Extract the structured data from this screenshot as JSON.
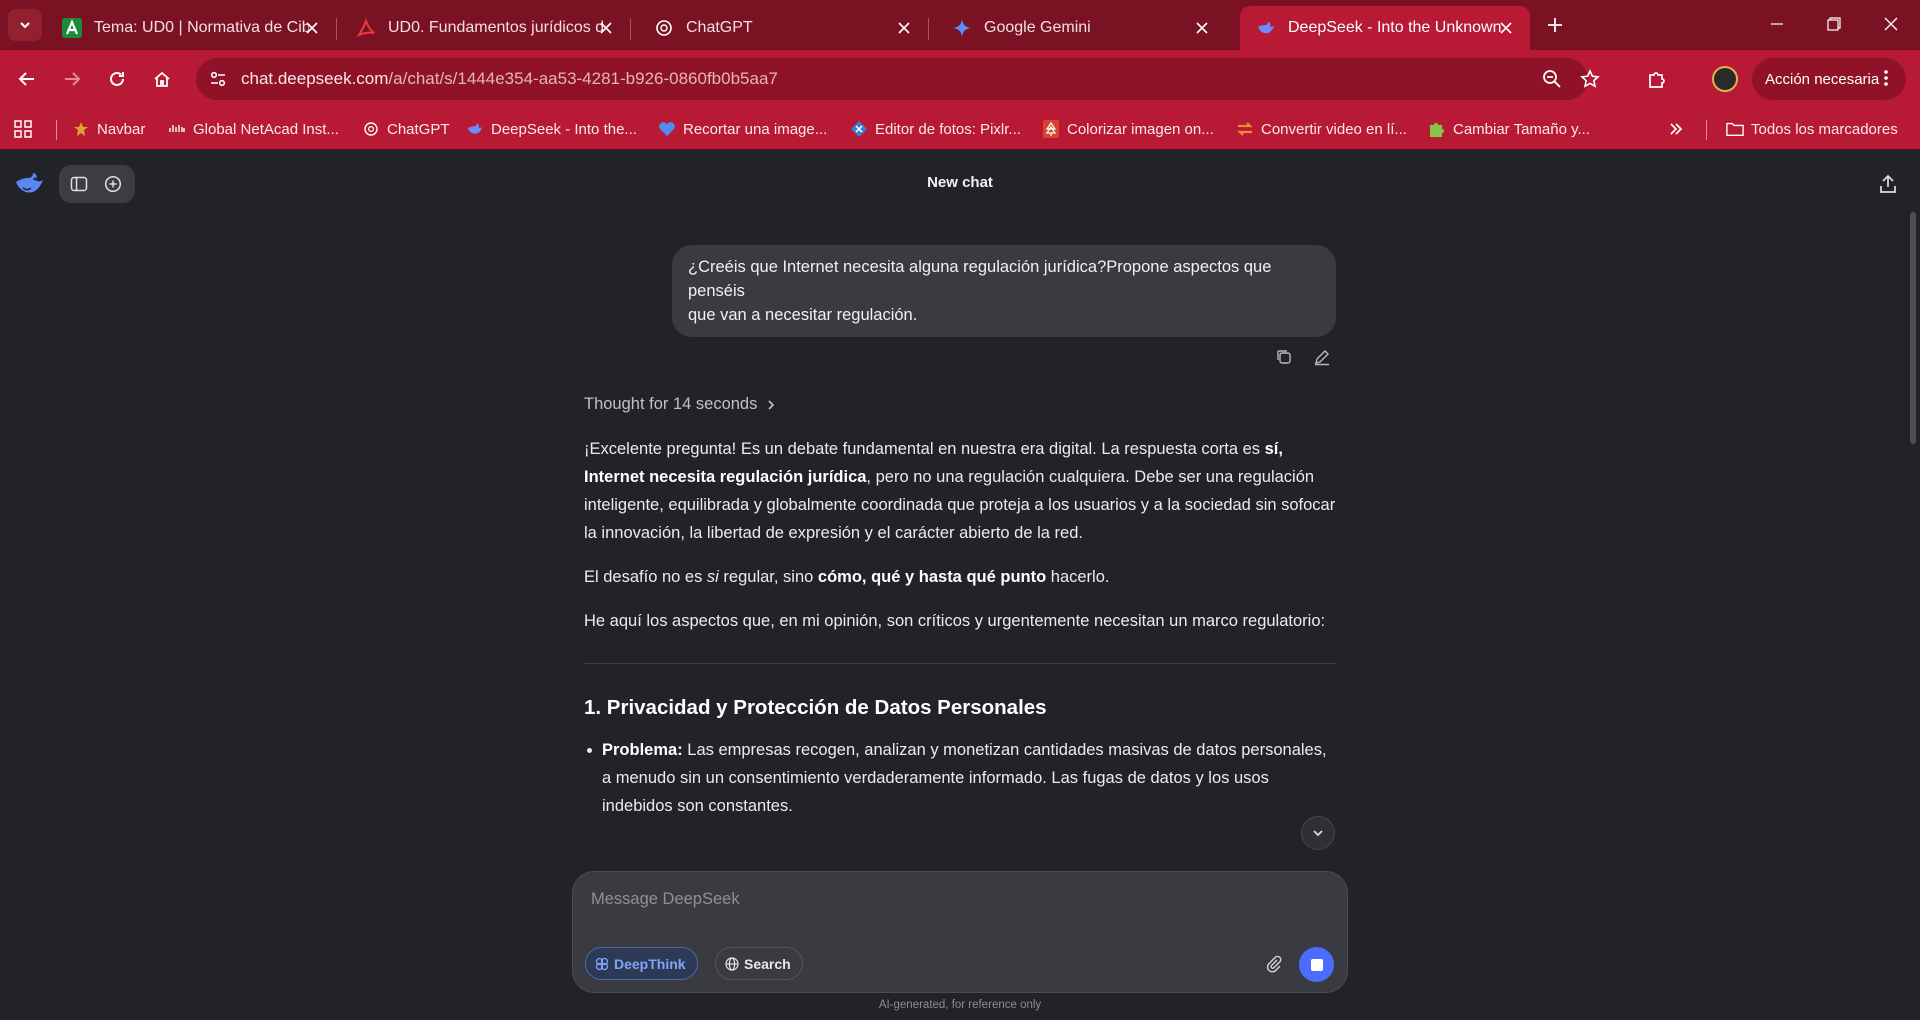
{
  "browser": {
    "tabs": [
      {
        "title": "Tema: UD0 | Normativa de Cibe",
        "icon": "a-logo-icon",
        "active": false
      },
      {
        "title": "UD0. Fundamentos jurídicos de",
        "icon": "pdf-icon",
        "active": false
      },
      {
        "title": "ChatGPT",
        "icon": "chatgpt-icon",
        "active": false
      },
      {
        "title": "Google Gemini",
        "icon": "gemini-icon",
        "active": false
      },
      {
        "title": "DeepSeek - Into the Unknown",
        "icon": "deepseek-icon",
        "active": true
      }
    ],
    "url_host": "chat.deepseek.com",
    "url_path": "/a/chat/s/1444e354-aa53-4281-b926-0860fb0b5aa7",
    "action_button": "Acción necesaria",
    "bookmarks": [
      {
        "label": "Navbar",
        "icon": "navbar-icon"
      },
      {
        "label": "Global NetAcad Inst...",
        "icon": "cisco-icon"
      },
      {
        "label": "ChatGPT",
        "icon": "chatgpt-icon"
      },
      {
        "label": "DeepSeek - Into the...",
        "icon": "deepseek-icon"
      },
      {
        "label": "Recortar una image...",
        "icon": "heart-icon"
      },
      {
        "label": "Editor de fotos: Pixlr...",
        "icon": "pixlr-icon"
      },
      {
        "label": "Colorizar imagen on...",
        "icon": "tree-icon"
      },
      {
        "label": "Convertir video en lí...",
        "icon": "convert-icon"
      },
      {
        "label": "Cambiar Tamaño y...",
        "icon": "puzzle-icon"
      }
    ],
    "all_bookmarks": "Todos los marcadores",
    "colors": {
      "frame": "#7a1224",
      "toolbar": "#b81a35"
    }
  },
  "app": {
    "title": "New chat",
    "user_message": {
      "line1": "¿Creéis que Internet necesita alguna regulación jurídica?Propone aspectos que",
      "line2": "penséis",
      "line3": "que van a necesitar regulación."
    },
    "thought_label": "Thought for 14 seconds",
    "answer": {
      "p1_a": "¡Excelente pregunta! Es un debate fundamental en nuestra era digital. La respuesta corta es ",
      "p1_b": "sí, Internet necesita regulación jurídica",
      "p1_c": ", pero no una regulación cualquiera. Debe ser una regulación inteligente, equilibrada y globalmente coordinada que proteja a los usuarios y a la sociedad sin sofocar la innovación, la libertad de expresión y el carácter abierto de la red.",
      "p2_a": "El desafío no es ",
      "p2_b": "si",
      "p2_c": " regular, sino ",
      "p2_d": "cómo, qué y hasta qué punto",
      "p2_e": " hacerlo.",
      "p3": "He aquí los aspectos que, en mi opinión, son críticos y urgentemente necesitan un marco regulatorio:",
      "h1": "1. Privacidad y Protección de Datos Personales",
      "li1_label": "Problema:",
      "li1_text": " Las empresas recogen, analizan y monetizan cantidades masivas de datos personales, a menudo sin un consentimiento verdaderamente informado. Las fugas de datos y los usos indebidos son constantes."
    },
    "composer": {
      "placeholder": "Message DeepSeek",
      "deepthink_label": "DeepThink",
      "search_label": "Search"
    },
    "disclaimer": "AI-generated, for reference only",
    "colors": {
      "background": "#212327",
      "accent": "#4d6bfe",
      "bubble": "#3a3b40"
    }
  }
}
